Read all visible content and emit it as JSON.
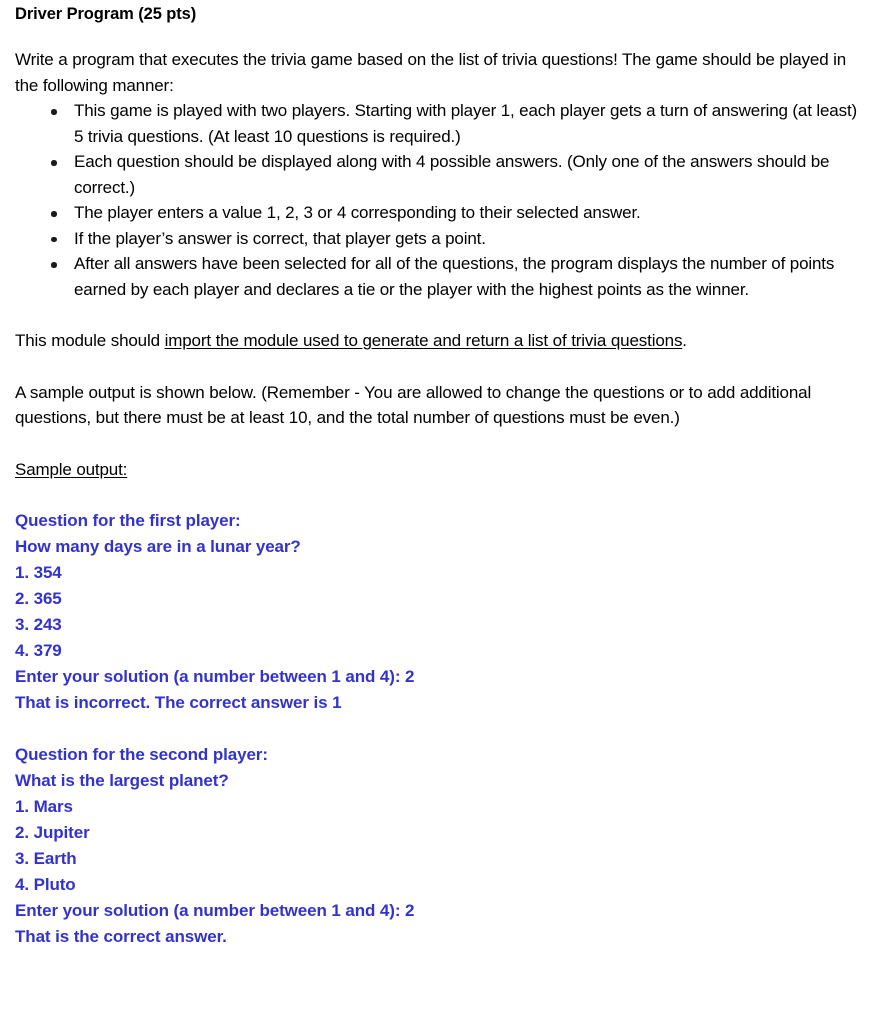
{
  "document": {
    "title": "Driver Program (25 pts)",
    "intro": "Write a program that executes the trivia game based on the list of trivia questions! The game should be played in the following manner:",
    "bullets": [
      "This game is played with two players. Starting with player 1, each player gets a turn of answering (at least) 5 trivia questions. (At least 10 questions is required.)",
      "Each question should be displayed along with 4 possible answers. (Only one of the answers should be correct.)",
      "The player enters a value 1, 2, 3 or 4 corresponding to their selected answer.",
      "If the player’s answer is correct, that player gets a point.",
      "After all answers have been selected for all of the questions, the program displays the number of points earned by each player and declares a tie or the player with the highest points as the winner."
    ],
    "module_note": {
      "plain": "This module should ",
      "underlined": "import the module used to generate and return a list of trivia questions",
      "trailing": "."
    },
    "sample_note": "A sample output is shown below. (Remember - You are allowed to change the questions or to add additional questions, but there must be at least 10, and the total number of questions must be even.)",
    "sample_output_heading": "Sample output:"
  },
  "sample_output": {
    "color": "#3333CC",
    "blocks": [
      {
        "lines": [
          "Question for the first player:",
          "How many days are in a lunar year?",
          "1. 354",
          "2. 365",
          "3. 243",
          "4. 379",
          "Enter your solution (a number between 1 and 4): 2",
          "That is incorrect. The correct answer is 1"
        ]
      },
      {
        "lines": [
          "Question for the second player:",
          "What is the largest planet?",
          "1. Mars",
          "2. Jupiter",
          "3. Earth",
          "4. Pluto",
          "Enter your solution (a number between 1 and 4): 2",
          "That is the correct answer."
        ]
      }
    ]
  }
}
